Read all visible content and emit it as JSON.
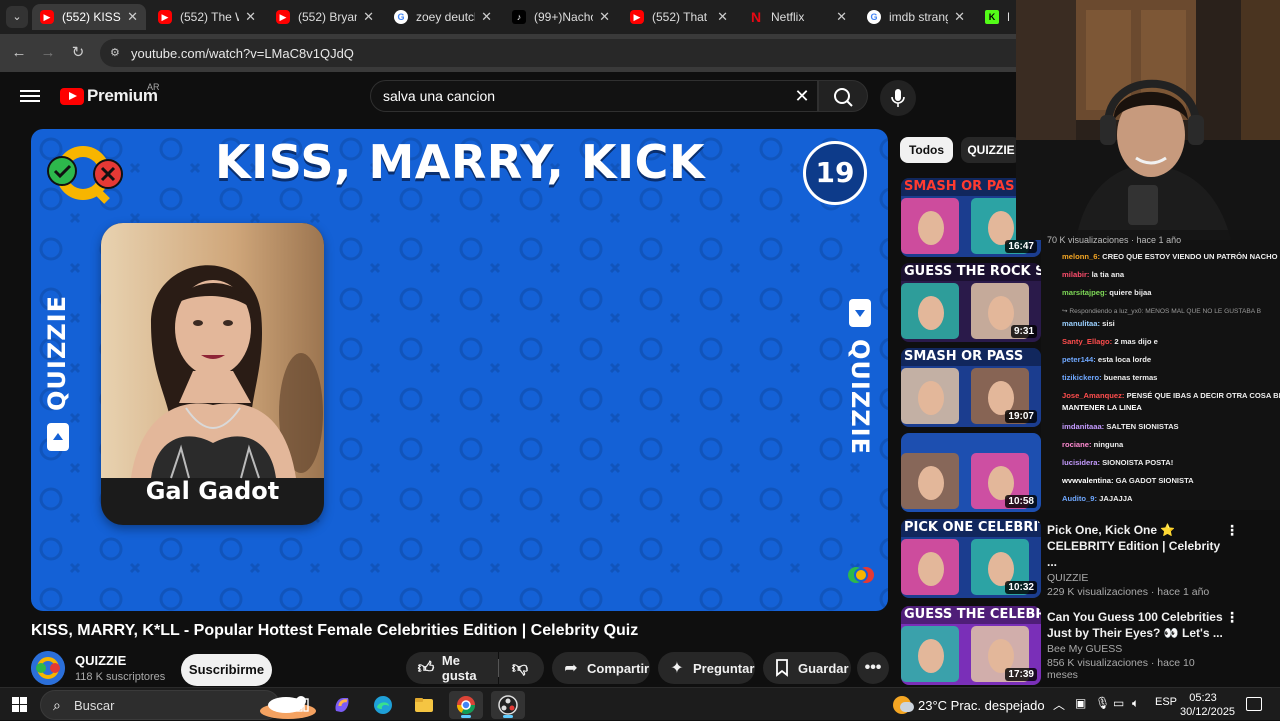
{
  "browser": {
    "tabs": [
      {
        "title": "(552) KISS, M",
        "favicon": "youtube-icon",
        "active": true
      },
      {
        "title": "(552) The We",
        "favicon": "youtube-icon",
        "active": false
      },
      {
        "title": "(552) Bryan A",
        "favicon": "youtube-icon",
        "active": false
      },
      {
        "title": "zoey deutch",
        "favicon": "google-icon",
        "active": false
      },
      {
        "title": "(99+)Nachoic",
        "favicon": "tiktok-icon",
        "active": false
      },
      {
        "title": "(552) That or",
        "favicon": "youtube-icon",
        "active": false
      },
      {
        "title": "Netflix",
        "favicon": "netflix-icon",
        "active": false
      },
      {
        "title": "imdb strange",
        "favicon": "google-icon",
        "active": false
      },
      {
        "title": "Bo",
        "favicon": "kick-icon",
        "active": false
      }
    ],
    "url": "youtube.com/watch?v=LMaC8v1QJdQ"
  },
  "youtube": {
    "logo_text": "Premium",
    "country_code": "AR",
    "search_value": "salva una cancion"
  },
  "video": {
    "art_title": "KISS, MARRY, KICK",
    "countdown": "19",
    "celebrity_name": "Gal Gadot",
    "side_brand": "QUIZZIE",
    "title": "KISS, MARRY, K*LL - Popular Hottest Female Celebrities Edition | Celebrity Quiz",
    "channel": "QUIZZIE",
    "subscribers": "118 K suscriptores",
    "subscribe_label": "Suscribirme",
    "like_label": "Me gusta",
    "share_label": "Compartir",
    "ask_label": "Preguntar",
    "save_label": "Guardar"
  },
  "sidebar": {
    "chips": [
      "Todos",
      "QUIZZIE"
    ],
    "videos": [
      {
        "thumb_text": "SMASH OR PAS",
        "duration": "16:47",
        "title": "",
        "channel": "",
        "stats": "",
        "thumb_bg": "#1b3d8f",
        "band_color": "#ff3b30"
      },
      {
        "thumb_text": "GUESS THE ROCK SONG",
        "duration": "9:31",
        "title": "",
        "channel": "",
        "stats": "",
        "thumb_bg": "#2a1a4a",
        "band_color": "#ffffff"
      },
      {
        "thumb_text": "SMASH OR PASS",
        "duration": "19:07",
        "title": "",
        "channel": "",
        "stats": "",
        "thumb_bg": "#1b3d8f",
        "band_color": "#ffffff"
      },
      {
        "thumb_text": "",
        "duration": "10:58",
        "title": "",
        "channel": "",
        "stats": "",
        "thumb_bg": "#1d4fb0",
        "band_color": "#ffffff"
      },
      {
        "thumb_text": "PICK ONE CELEBRITY",
        "duration": "10:32",
        "title": "Pick One, Kick One ⭐ CELEBRITY Edition | Celebrity ...",
        "channel": "QUIZZIE",
        "stats": "229 K visualizaciones · hace 1 año",
        "thumb_bg": "#1b3d8f",
        "band_color": "#ffffff"
      },
      {
        "thumb_text": "GUESS THE CELEBRITY",
        "duration": "17:39",
        "title": "Can You Guess 100 Celebrities Just by Their Eyes? 👀 Let's ...",
        "channel": "Bee My GUESS",
        "stats": "856 K visualizaciones · hace 10 meses",
        "thumb_bg": "#7a2fb8",
        "band_color": "#ffffff"
      }
    ]
  },
  "chat": {
    "header_fragment": "70 K visualizaciones · hace 1 año",
    "messages": [
      {
        "user": "melonn_6:",
        "text": "CREO QUE ESTOY VIENDO UN PATRÓN NACHO",
        "color": "#f5a623"
      },
      {
        "user": "milabir:",
        "text": "la tia ana",
        "color": "#ff4d6d"
      },
      {
        "user": "marsitajpeg:",
        "text": "quiere bijaa",
        "color": "#7ed957"
      },
      {
        "user": "",
        "text": "↪ Respondiendo a luz_yx0: MENOS MAL QUE NO LE GUSTABA B",
        "color": "#999999",
        "reply": true
      },
      {
        "user": "manulitaa:",
        "text": "sisi",
        "color": "#9ad0ff"
      },
      {
        "user": "Santy_Ellago:",
        "text": "2 mas dijo e",
        "color": "#ff4d4d"
      },
      {
        "user": "peter144:",
        "text": "esta loca lorde",
        "color": "#6fa8ff"
      },
      {
        "user": "tizikickero:",
        "text": "buenas termas",
        "color": "#6fa8ff"
      },
      {
        "user": "Jose_Amanquez:",
        "text": "PENSÉ QUE IBAS A DECIR OTRA COSA BI",
        "color": "#ff4d4d"
      },
      {
        "user": "",
        "text": "MANTENER LA LINEA",
        "color": "#ffffff"
      },
      {
        "user": "imdanitaaa:",
        "text": "SALTEN SIONISTAS",
        "color": "#c59bff"
      },
      {
        "user": "rociane:",
        "text": "ninguna",
        "color": "#ff8ad1"
      },
      {
        "user": "lucisidera:",
        "text": "SIONOISTA POSTA!",
        "color": "#c59bff"
      },
      {
        "user": "wvwvalentina:",
        "text": "GA GADOT SIONISTA",
        "color": "#ffffff"
      },
      {
        "user": "Audito_9:",
        "text": "JAJAJJA",
        "color": "#6fa8ff"
      }
    ]
  },
  "taskbar": {
    "search_placeholder": "Buscar",
    "weather_temp": "23°C",
    "weather_desc": "Prac. despejado",
    "language": "ESP",
    "time": "05:23",
    "date": "30/12/2025"
  },
  "colors": {
    "video_bg": "#1461d6",
    "youtube_red": "#ff0000",
    "page_bg": "#0f0f0f"
  }
}
